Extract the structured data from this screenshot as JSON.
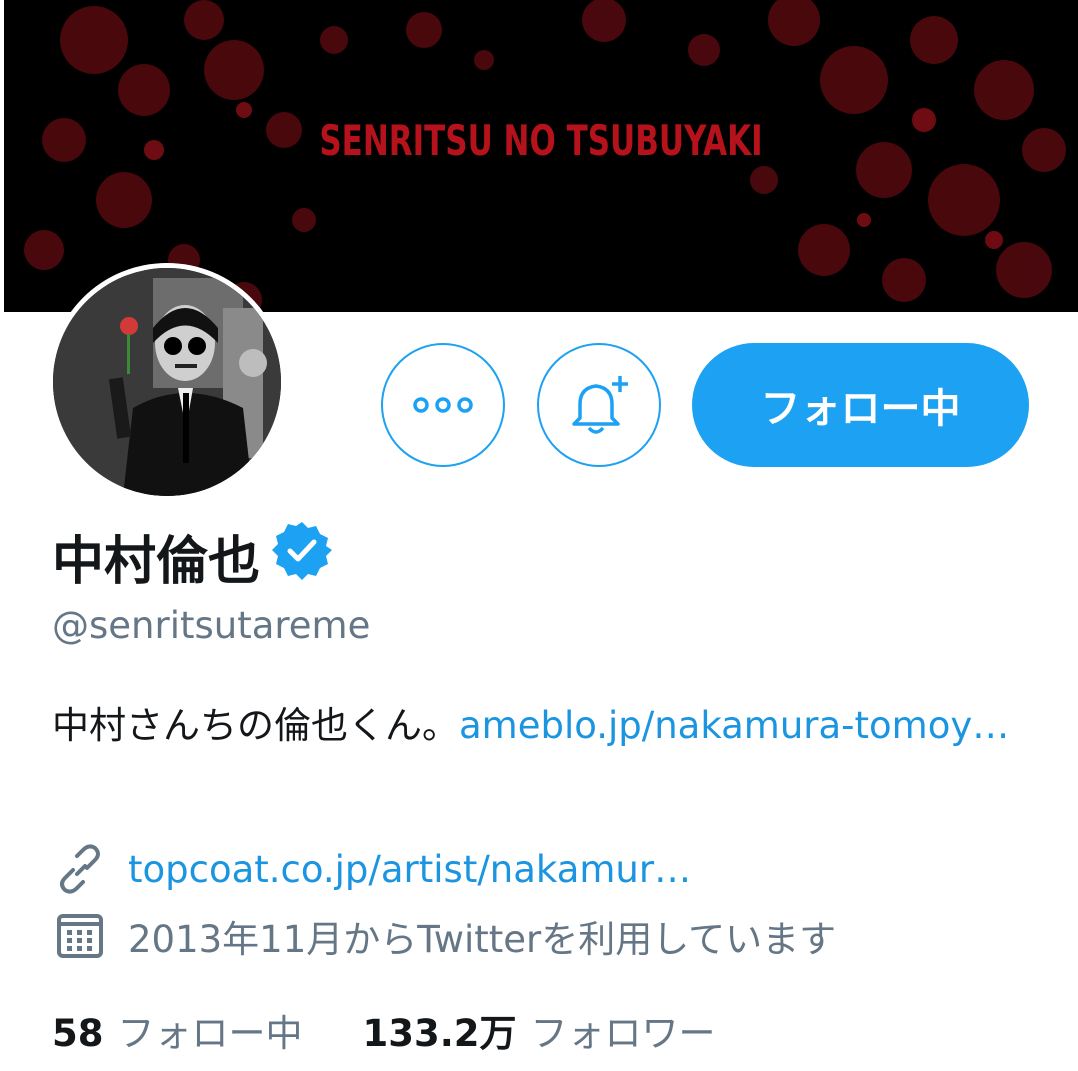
{
  "banner": {
    "title": "SENRITSU NO TSUBUYAKI",
    "accent": "#b5121b"
  },
  "profile": {
    "name": "中村倫也",
    "handle": "@senritsutareme",
    "verified": true,
    "bio_text": "中村さんちの倫也くん。",
    "bio_link": "ameblo.jp/nakamura-tomoy…",
    "website": "topcoat.co.jp/artist/nakamur…",
    "joined": "2013年11月からTwitterを利用しています"
  },
  "actions": {
    "more_icon": "more-icon",
    "notify_icon": "bell-plus-icon",
    "follow_label": "フォロー中"
  },
  "stats": {
    "following_count": "58",
    "following_label": "フォロー中",
    "followers_count": "133.2万",
    "followers_label": "フォロワー"
  },
  "colors": {
    "brand": "#1da1f2",
    "link": "#1b95e0",
    "muted": "#657786"
  }
}
